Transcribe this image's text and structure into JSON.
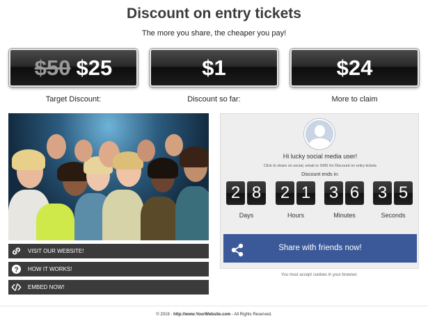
{
  "header": {
    "title": "Discount on entry tickets",
    "subtitle": "The more you share, the cheaper you pay!"
  },
  "prices": [
    {
      "old": "$50",
      "value": "$25",
      "caption": "Target Discount:"
    },
    {
      "value": "$1",
      "caption": "Discount so far:"
    },
    {
      "value": "$24",
      "caption": "More to claim"
    }
  ],
  "links": [
    {
      "label": "VISIT OUR WEBSITE!",
      "icon": "link-icon"
    },
    {
      "label": "HOW IT WORKS!",
      "icon": "question-icon"
    },
    {
      "label": "EMBED NOW!",
      "icon": "code-icon"
    }
  ],
  "panel": {
    "greeting": "Hi lucky social media user!",
    "note": "Click to share on social, email or SMS for Discount on entry tickets",
    "ends_label": "Discount ends in:",
    "countdown": [
      {
        "digits": [
          "2",
          "8"
        ],
        "unit": "Days"
      },
      {
        "digits": [
          "2",
          "1"
        ],
        "unit": "Hours"
      },
      {
        "digits": [
          "3",
          "6"
        ],
        "unit": "Minutes"
      },
      {
        "digits": [
          "3",
          "5"
        ],
        "unit": "Seconds"
      }
    ],
    "share_label": "Share with friends now!",
    "share_color": "#3b5899"
  },
  "cookie_note": "You must accept cookies in your browser.",
  "footer": {
    "prefix": "© 2019 - ",
    "link": "http://www.YourWebsite.com",
    "suffix": " - All Rights Reserved."
  }
}
